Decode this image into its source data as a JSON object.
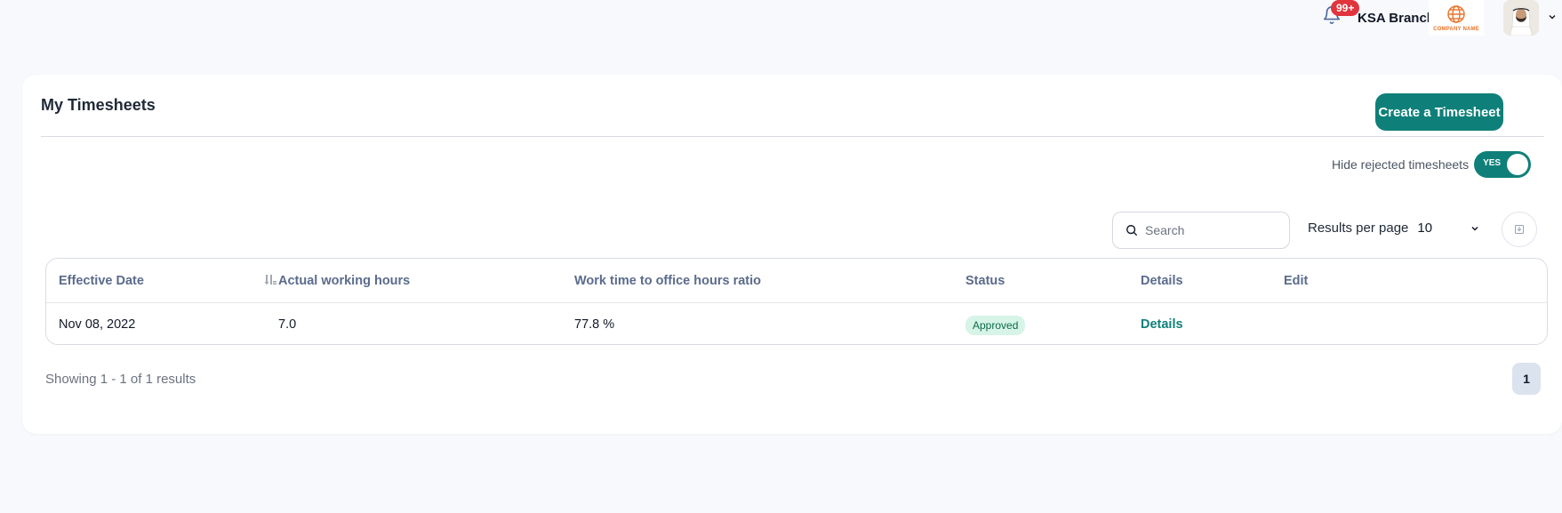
{
  "topbar": {
    "notifications_count": "99+",
    "branch_label": "KSA Branch",
    "company_logo_text": "COMPANY NAME",
    "icons": {
      "bell": "bell-icon",
      "chevron": "chevron-down-icon",
      "avatar": "user-avatar"
    }
  },
  "page": {
    "title": "My Timesheets",
    "create_button": "Create a Timesheet",
    "hide_rejected_label": "Hide rejected timesheets",
    "hide_rejected_toggle": "YES",
    "search_placeholder": "Search",
    "results_per_page_label": "Results per page",
    "results_per_page_value": "10"
  },
  "table": {
    "headers": {
      "effective_date": "Effective Date",
      "actual_hours": "Actual working hours",
      "ratio": "Work time to office hours ratio",
      "status": "Status",
      "details": "Details",
      "edit": "Edit"
    },
    "rows": [
      {
        "effective_date": "Nov 08, 2022",
        "actual_hours": "7.0",
        "ratio": "77.8 %",
        "status": "Approved",
        "details": "Details"
      }
    ]
  },
  "footer": {
    "showing_text": "Showing 1 - 1 of 1 results",
    "current_page": "1"
  },
  "colors": {
    "accent": "#0f8079",
    "badge_red": "#e1343c",
    "status_approved_bg": "#d6f4e7",
    "status_approved_text": "#0d6b48",
    "header_text": "#5b6b8c"
  }
}
